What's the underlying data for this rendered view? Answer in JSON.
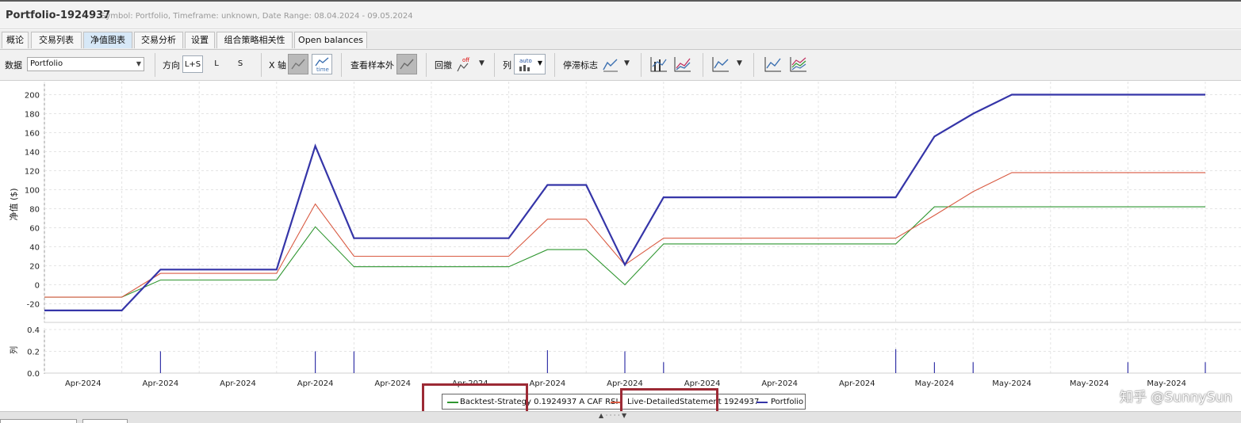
{
  "window": {
    "title": "Portfolio-1924937",
    "subtitle": "Symbol: Portfolio, Timeframe: unknown, Date Range: 08.04.2024 - 09.05.2024"
  },
  "tabs": [
    {
      "label": "概论",
      "active": false
    },
    {
      "label": "交易列表",
      "active": false
    },
    {
      "label": "净值图表",
      "active": true
    },
    {
      "label": "交易分析",
      "active": false
    },
    {
      "label": "设置",
      "active": false
    },
    {
      "label": "组合策略相关性",
      "active": false
    },
    {
      "label": "Open balances",
      "active": false
    }
  ],
  "toolbar": {
    "data_label": "数据",
    "data_value": "Portfolio",
    "direction_label": "方向",
    "direction_options": [
      "L+S",
      "L",
      "S"
    ],
    "direction_selected": "L+S",
    "xaxis_label": "X 轴",
    "xaxis_time_text": "time",
    "oos_label": "查看样本外",
    "drawdown_label": "回撤",
    "drawdown_off_text": "off",
    "column_label": "列",
    "column_auto_text": "auto",
    "stagnation_label": "停滞标志"
  },
  "colors": {
    "backtest": "#2f9630",
    "live": "#d95b43",
    "portfolio": "#3535a8",
    "grid": "#e4e4e4",
    "tab_active": "#d7e8f7",
    "highlight_box": "#9c2a35"
  },
  "chart_data": {
    "type": "line",
    "ylabel": "净值 ($)",
    "ylim": [
      -30,
      210
    ],
    "yticks": [
      -20,
      0,
      20,
      40,
      60,
      80,
      100,
      120,
      140,
      160,
      180,
      200
    ],
    "grid": true,
    "x": [
      0,
      1,
      1.5,
      3,
      3.5,
      4,
      4.5,
      6,
      6.5,
      7,
      7.5,
      8,
      8.5,
      10.5,
      11,
      11.5,
      12,
      12.5,
      15
    ],
    "xtick_labels": [
      "Apr-2024",
      "Apr-2024",
      "Apr-2024",
      "Apr-2024",
      "Apr-2024",
      "Apr-2024",
      "Apr-2024",
      "Apr-2024",
      "Apr-2024",
      "Apr-2024",
      "Apr-2024",
      "May-2024",
      "May-2024",
      "May-2024",
      "May-2024"
    ],
    "series": [
      {
        "name": "Backtest-Strategy 0.1924937 A CAF RSI",
        "values": [
          -13,
          -13,
          5,
          5,
          61,
          19,
          19,
          19,
          37,
          37,
          0,
          43,
          43,
          43,
          43,
          82,
          82,
          82,
          82
        ]
      },
      {
        "name": "Live-DetailedStatement 1924937",
        "values": [
          -13,
          -13,
          12,
          12,
          85,
          30,
          30,
          30,
          69,
          69,
          21,
          49,
          49,
          49,
          49,
          73,
          98,
          118,
          118
        ]
      },
      {
        "name": "Portfolio",
        "values": [
          -27,
          -27,
          16,
          16,
          146,
          49,
          49,
          49,
          105,
          105,
          21,
          92,
          92,
          92,
          92,
          156,
          180,
          200,
          200
        ]
      }
    ],
    "sub_chart": {
      "type": "bar",
      "ylabel": "列",
      "ylim": [
        0,
        0.4
      ],
      "yticks": [
        "0.0",
        "0.2",
        "0.4"
      ],
      "x": [
        1.5,
        3.5,
        4,
        6.5,
        7.5,
        8,
        11,
        11.5,
        12,
        14,
        15
      ],
      "values": [
        0.2,
        0.2,
        0.2,
        0.21,
        0.2,
        0.1,
        0.22,
        0.1,
        0.1,
        0.1,
        0.1
      ]
    },
    "legend": {
      "position": "bottom-center"
    }
  },
  "watermark": "知乎 @SunnySun"
}
